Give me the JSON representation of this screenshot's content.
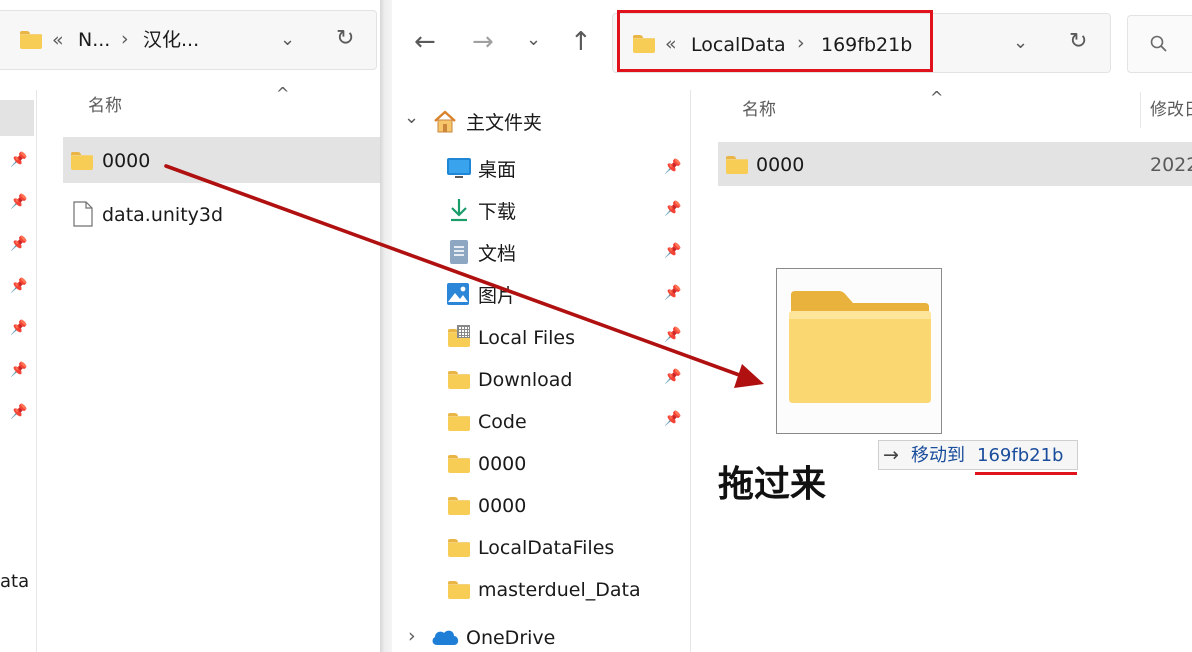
{
  "left_window": {
    "address": {
      "chevron": "«",
      "segment1": "N...",
      "separator": "›",
      "segment2": "汉化..."
    },
    "column_name": "名称",
    "sort_glyph": "^",
    "files": [
      {
        "name": "0000",
        "type": "folder"
      },
      {
        "name": "data.unity3d",
        "type": "file"
      }
    ],
    "edge_label": "ata"
  },
  "right_window": {
    "address": {
      "chevron": "«",
      "segment1": "LocalData",
      "separator": "›",
      "segment2": "169fb21b"
    },
    "search_icon": "search-icon",
    "column_name": "名称",
    "column_modified": "修改日",
    "sort_glyph": "^",
    "files": [
      {
        "name": "0000",
        "date": "2022"
      }
    ],
    "nav": {
      "home": {
        "label": "主文件夹",
        "expander": "⌄"
      },
      "items": [
        {
          "label": "桌面",
          "icon": "desktop-icon",
          "pinned": true
        },
        {
          "label": "下载",
          "icon": "download-icon",
          "pinned": true
        },
        {
          "label": "文档",
          "icon": "document-icon",
          "pinned": true
        },
        {
          "label": "图片",
          "icon": "pictures-icon",
          "pinned": true
        },
        {
          "label": "Local Files",
          "icon": "folder-grid-icon",
          "pinned": true
        },
        {
          "label": "Download",
          "icon": "folder-icon",
          "pinned": true
        },
        {
          "label": "Code",
          "icon": "folder-icon",
          "pinned": true
        },
        {
          "label": "0000",
          "icon": "folder-icon",
          "pinned": false
        },
        {
          "label": "0000",
          "icon": "folder-icon",
          "pinned": false
        },
        {
          "label": "LocalDataFiles",
          "icon": "folder-icon",
          "pinned": false
        },
        {
          "label": "masterduel_Data",
          "icon": "folder-icon",
          "pinned": false
        }
      ],
      "onedrive": {
        "label": "OneDrive",
        "expander": "›"
      }
    },
    "drag_tooltip": {
      "arrow": "→",
      "action": "移动到",
      "target": "169fb21b"
    }
  },
  "annotation": {
    "text": "拖过来",
    "arrow_color": "#b01010",
    "highlight_color": "#e0121b"
  }
}
